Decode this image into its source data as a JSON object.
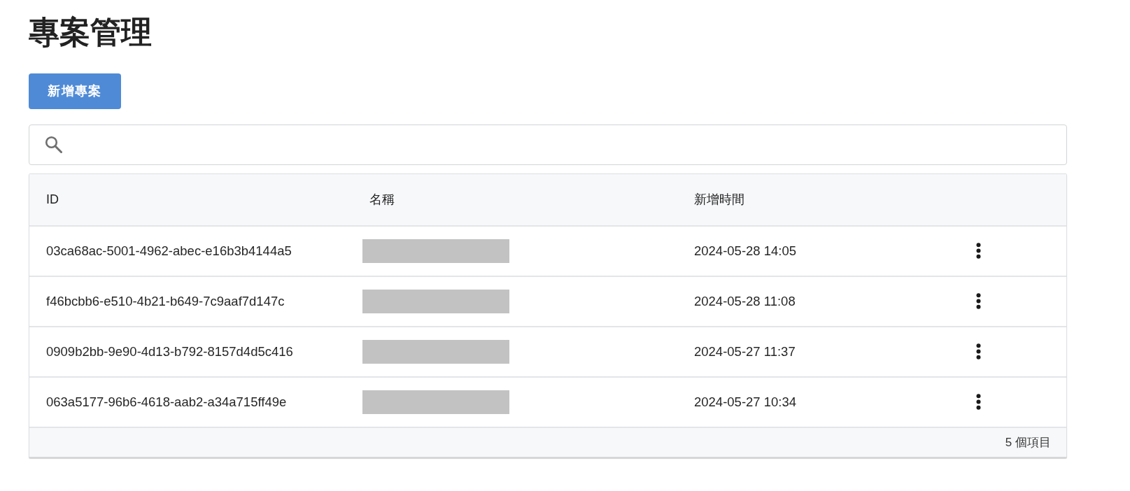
{
  "page": {
    "title": "專案管理"
  },
  "toolbar": {
    "add_button": "新增專案"
  },
  "table": {
    "columns": [
      "ID",
      "名稱",
      "新增時間"
    ],
    "rows": [
      {
        "id": "03ca68ac-5001-4962-abec-e16b3b4144a5",
        "created": "2024-05-28 14:05"
      },
      {
        "id": "f46bcbb6-e510-4b21-b649-7c9aaf7d147c",
        "created": "2024-05-28 11:08"
      },
      {
        "id": "0909b2bb-9e90-4d13-b792-8157d4d5c416",
        "created": "2024-05-27 11:37"
      },
      {
        "id": "063a5177-96b6-4618-aab2-a34a715ff49e",
        "created": "2024-05-27 10:34"
      }
    ],
    "footer": "5 個項目"
  }
}
